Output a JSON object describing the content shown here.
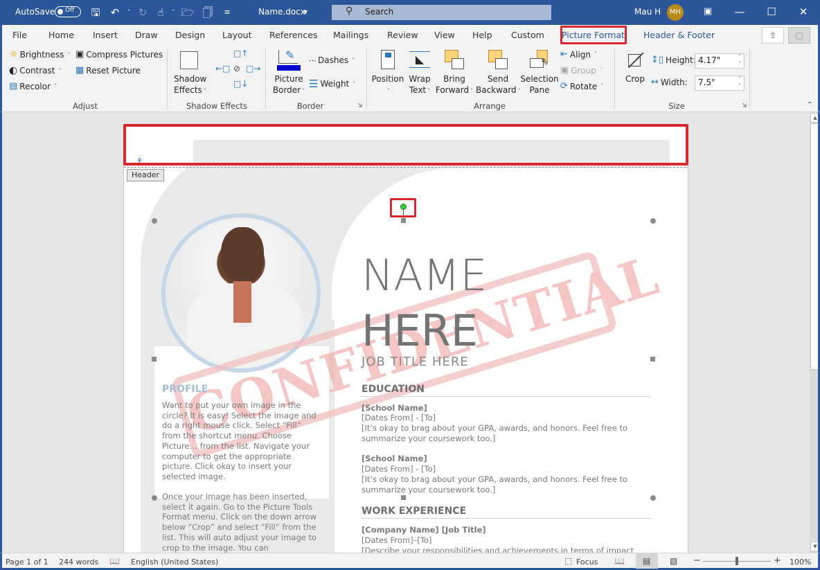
{
  "titlebar": {
    "autosave_label": "AutoSave",
    "autosave_state": "Off",
    "doc_name": "Name.docx",
    "search_placeholder": "Search",
    "user_name": "Mau H",
    "user_initials": "MH"
  },
  "tabs": [
    "File",
    "Home",
    "Insert",
    "Draw",
    "Design",
    "Layout",
    "References",
    "Mailings",
    "Review",
    "View",
    "Help",
    "Custom",
    "Picture Format",
    "Header & Footer"
  ],
  "active_tab": "Picture Format",
  "ribbon": {
    "adjust": {
      "items": [
        "Brightness",
        "Contrast",
        "Recolor",
        "Compress Pictures",
        "Reset Picture"
      ],
      "label": "Adjust"
    },
    "shadow": {
      "button_line1": "Shadow",
      "button_line2": "Effects",
      "label": "Shadow Effects"
    },
    "border": {
      "picture_border_1": "Picture",
      "picture_border_2": "Border",
      "dashes": "Dashes",
      "weight": "Weight",
      "label": "Border",
      "border_color": "#0000cc"
    },
    "arrange": {
      "position": "Position",
      "wrap_1": "Wrap",
      "wrap_2": "Text",
      "bring_1": "Bring",
      "bring_2": "Forward",
      "send_1": "Send",
      "send_2": "Backward",
      "selection_1": "Selection",
      "selection_2": "Pane",
      "align": "Align",
      "group": "Group",
      "rotate": "Rotate",
      "label": "Arrange"
    },
    "size": {
      "crop": "Crop",
      "height_label": "Height:",
      "height_value": "4.17\"",
      "width_label": "Width:",
      "width_value": "7.5\"",
      "label": "Size"
    }
  },
  "document": {
    "header_tag": "Header",
    "watermark": "CONFIDENTIAL",
    "name_line1": "NAME",
    "name_line2": "HERE",
    "job_title": "JOB TITLE HERE",
    "profile_heading": "PROFILE",
    "profile_p1": "Want to put your own image in the circle?  It is easy!  Select the image and do a right mouse click.  Select “Fill” from the shortcut menu.  Choose Picture… from the list.  Navigate your computer to get the appropriate picture.  Click okay to insert your selected image.",
    "profile_p2": "Once your image has been inserted, select it again.  Go to the Picture Tools Format menu. Click on the down arrow below “Crop” and select “Fill” from the list.  This will auto adjust your image to crop to the image.  You can",
    "education_heading": "EDUCATION",
    "education": [
      {
        "school": "[School Name]",
        "dates": "[Dates From] - [To]",
        "desc": "[It’s okay to brag about your GPA, awards, and honors. Feel free to summarize your coursework too.]"
      },
      {
        "school": "[School Name]",
        "dates": "[Dates From] - [To]",
        "desc": "[It’s okay to brag about your GPA, awards, and honors. Feel free to summarize your coursework too.]"
      }
    ],
    "work_heading": "WORK EXPERIENCE",
    "work": {
      "company": "[Company Name]  [Job Title]",
      "dates": "[Dates From]–[To]",
      "desc": "[Describe your responsibilities and achievements in terms of impact"
    }
  },
  "status": {
    "page": "Page 1 of 1",
    "words": "244 words",
    "language": "English (United States)",
    "focus": "Focus",
    "zoom": "100%",
    "zoom_percent": 100
  },
  "colors": {
    "accent": "#2b579a",
    "highlight_box": "#d7282f",
    "watermark": "#f2b8b8"
  }
}
